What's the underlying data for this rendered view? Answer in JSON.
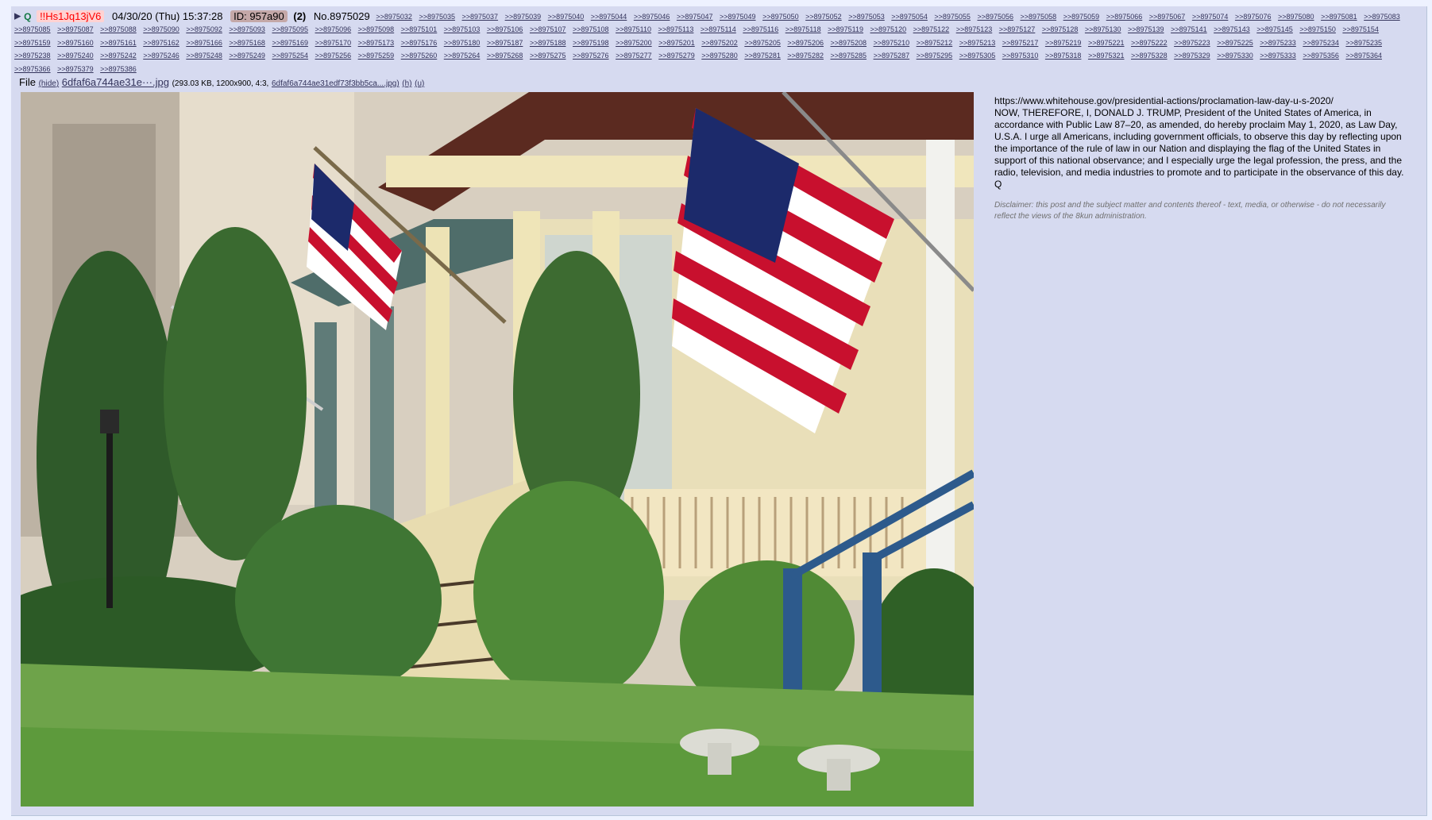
{
  "post": {
    "arrow": "▶",
    "q_label": "Q",
    "tripcode": "!!Hs1Jq13jV6",
    "datetime": "04/30/20 (Thu) 15:37:28",
    "id_label": "ID: 957a90",
    "reply_count": "(2)",
    "post_number": "No.8975029",
    "replies": [
      ">>8975032",
      ">>8975035",
      ">>8975037",
      ">>8975039",
      ">>8975040",
      ">>8975044",
      ">>8975046",
      ">>8975047",
      ">>8975049",
      ">>8975050",
      ">>8975052",
      ">>8975053",
      ">>8975054",
      ">>8975055",
      ">>8975056",
      ">>8975058",
      ">>8975059",
      ">>8975066",
      ">>8975067",
      ">>8975074",
      ">>8975076",
      ">>8975080",
      ">>8975081",
      ">>8975083",
      ">>8975085",
      ">>8975087",
      ">>8975088",
      ">>8975090",
      ">>8975092",
      ">>8975093",
      ">>8975095",
      ">>8975096",
      ">>8975098",
      ">>8975101",
      ">>8975103",
      ">>8975106",
      ">>8975107",
      ">>8975108",
      ">>8975110",
      ">>8975113",
      ">>8975114",
      ">>8975116",
      ">>8975118",
      ">>8975119",
      ">>8975120",
      ">>8975122",
      ">>8975123",
      ">>8975127",
      ">>8975128",
      ">>8975130",
      ">>8975139",
      ">>8975141",
      ">>8975143",
      ">>8975145",
      ">>8975150",
      ">>8975154",
      ">>8975159",
      ">>8975160",
      ">>8975161",
      ">>8975162",
      ">>8975166",
      ">>8975168",
      ">>8975169",
      ">>8975170",
      ">>8975173",
      ">>8975176",
      ">>8975180",
      ">>8975187",
      ">>8975188",
      ">>8975198",
      ">>8975200",
      ">>8975201",
      ">>8975202",
      ">>8975205",
      ">>8975206",
      ">>8975208",
      ">>8975210",
      ">>8975212",
      ">>8975213",
      ">>8975217",
      ">>8975219",
      ">>8975221",
      ">>8975222",
      ">>8975223",
      ">>8975225",
      ">>8975233",
      ">>8975234",
      ">>8975235",
      ">>8975238",
      ">>8975240",
      ">>8975242",
      ">>8975246",
      ">>8975248",
      ">>8975249",
      ">>8975254",
      ">>8975256",
      ">>8975259",
      ">>8975260",
      ">>8975264",
      ">>8975268",
      ">>8975275",
      ">>8975276",
      ">>8975277",
      ">>8975279",
      ">>8975280",
      ">>8975281",
      ">>8975282",
      ">>8975285",
      ">>8975287",
      ">>8975295",
      ">>8975305",
      ">>8975310",
      ">>8975318",
      ">>8975321",
      ">>8975328",
      ">>8975329",
      ">>8975330",
      ">>8975333",
      ">>8975356",
      ">>8975364",
      ">>8975366",
      ">>8975379",
      ">>8975386"
    ]
  },
  "file": {
    "label": "File",
    "hide_link": "(hide)",
    "filename": "6dfaf6a744ae31e···.jpg",
    "meta": "(293.03 KB, 1200x900, 4:3,",
    "original_name": "6dfaf6a744ae31edf73f3bb5ca....jpg)",
    "h_link": "(h)",
    "u_link": "(u)"
  },
  "message": {
    "lines": [
      "https://www.whitehouse.gov/presidential-actions/proclamation-law-day-u-s-2020/",
      "NOW, THEREFORE, I, DONALD J. TRUMP, President of the United States of America, in accordance with Public Law 87–20, as amended, do hereby proclaim May 1, 2020, as Law Day, U.S.A.   I urge all Americans, including government officials, to observe this day by reflecting upon the importance of the rule of law in our Nation and displaying the flag of the United States in support of this national observance; and I especially urge the legal profession, the press, and the radio, television, and media industries to promote and to participate in the observance of this day.",
      "Q"
    ],
    "disclaimer": "Disclaimer: this post and the subject matter and contents thereof - text, media, or otherwise - do not necessarily reflect the views of the 8kun administration."
  }
}
